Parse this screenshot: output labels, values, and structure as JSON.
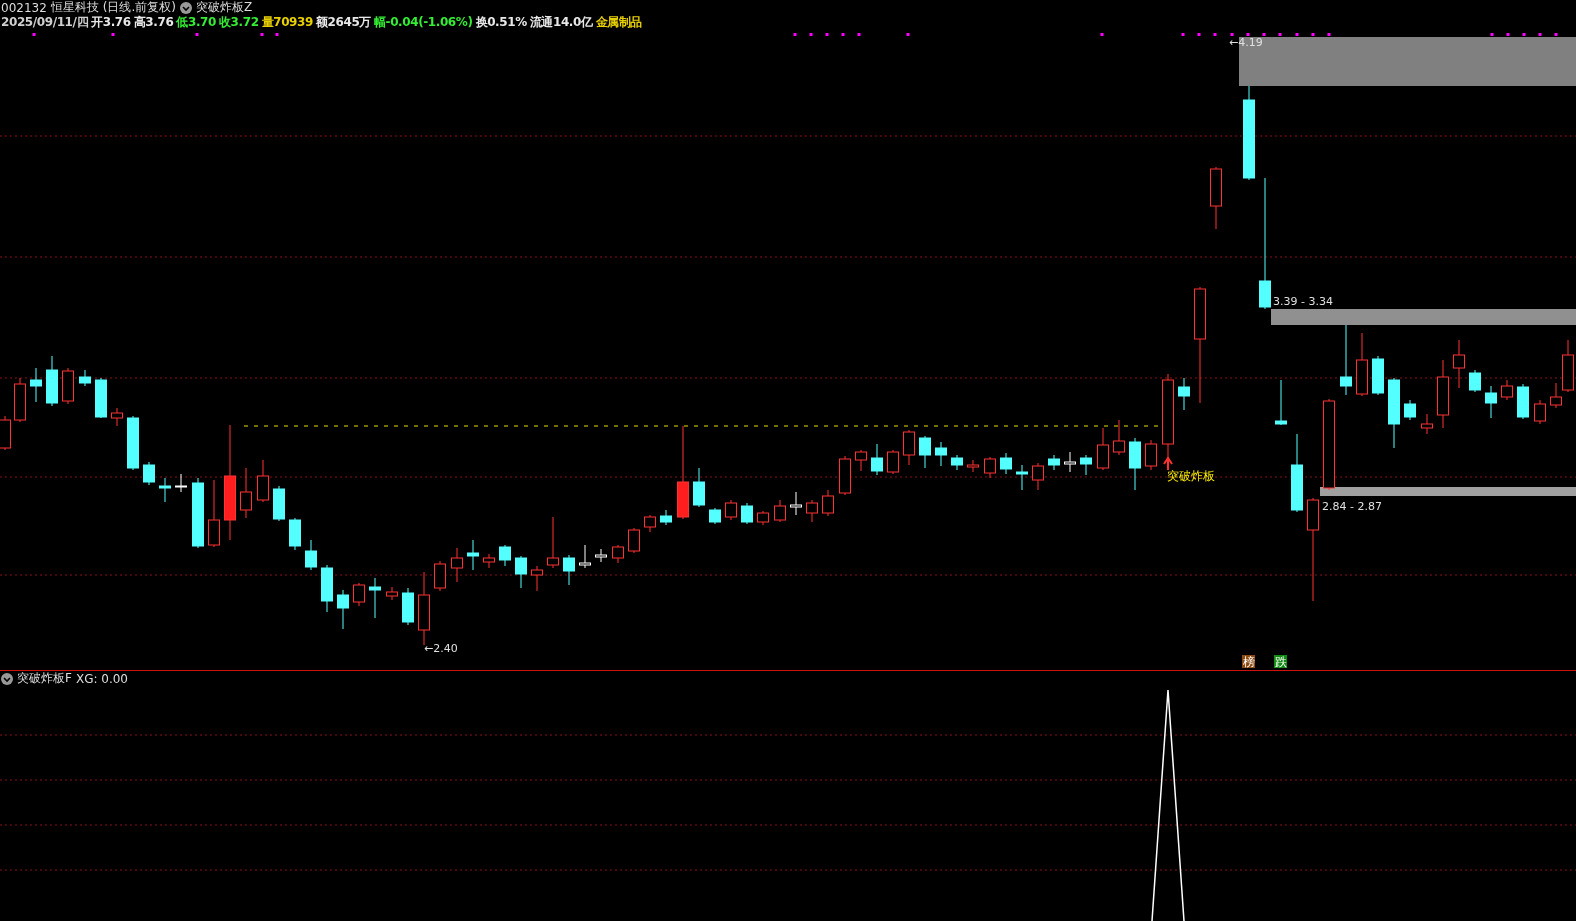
{
  "title_bar": {
    "code": "002132",
    "name": "恒星科技",
    "period": "(日线.前复权)",
    "indicator": "突破炸板Z"
  },
  "quote": [
    {
      "text": "2025/09/11/四",
      "color": "#d0d0d0"
    },
    {
      "text": "开3.76",
      "color": "#e8e8e8"
    },
    {
      "text": "高3.76",
      "color": "#e8e8e8"
    },
    {
      "text": "低3.70",
      "color": "#33ee33"
    },
    {
      "text": "收3.72",
      "color": "#33ee33"
    },
    {
      "text": "量70939",
      "color": "#e8d000"
    },
    {
      "text": "额2645万",
      "color": "#e8e8e8"
    },
    {
      "text": "幅-0.04(-1.06%)",
      "color": "#33ee33"
    },
    {
      "text": "换0.51%",
      "color": "#e8e8e8"
    },
    {
      "text": "流通14.0亿",
      "color": "#e8e8e8"
    },
    {
      "text": "金属制品",
      "color": "#e8d000"
    }
  ],
  "chart_labels": {
    "high": "←4.19",
    "low": "←2.40",
    "zone_upper": "3.39 - 3.34",
    "zone_lower": "2.84 - 2.87",
    "signal": "突破炸板"
  },
  "badges": [
    {
      "text": "榜",
      "color": "#8b4a10"
    },
    {
      "text": "跌",
      "color": "#108a10"
    }
  ],
  "indicator_panel": {
    "name": "突破炸板F",
    "value": "XG: 0.00"
  }
}
